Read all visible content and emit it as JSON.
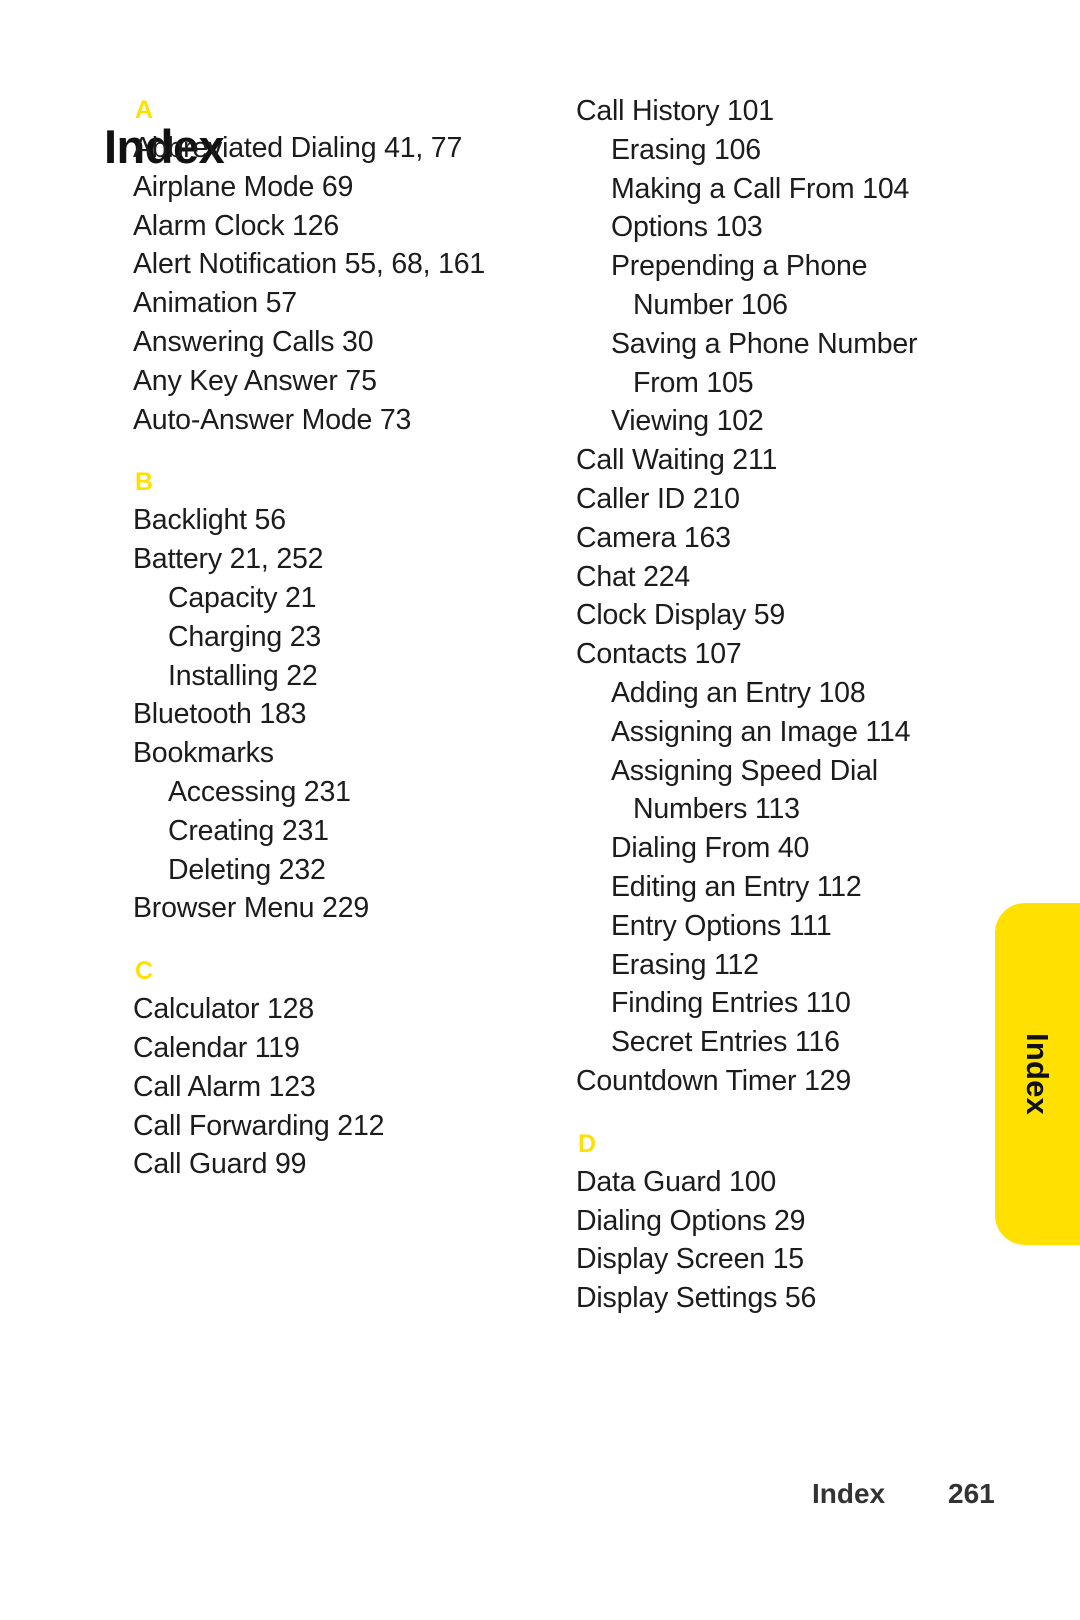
{
  "page": {
    "title": "Index",
    "side_tab_label": "Index",
    "footer_label": "Index",
    "footer_page_number": "261",
    "accent_color": "#FFE000",
    "text_color": "#1c1c1c"
  },
  "columns": [
    {
      "name": "left-column",
      "groups": [
        {
          "letter": "A",
          "entries": [
            {
              "text": "Abbreviated Dialing 41, 77",
              "level": 0
            },
            {
              "text": "Airplane Mode 69",
              "level": 0
            },
            {
              "text": "Alarm Clock 126",
              "level": 0
            },
            {
              "text": "Alert Notification 55, 68, 161",
              "level": 0
            },
            {
              "text": "Animation 57",
              "level": 0
            },
            {
              "text": "Answering Calls 30",
              "level": 0
            },
            {
              "text": "Any Key Answer 75",
              "level": 0
            },
            {
              "text": "Auto-Answer Mode 73",
              "level": 0
            }
          ]
        },
        {
          "letter": "B",
          "entries": [
            {
              "text": "Backlight 56",
              "level": 0
            },
            {
              "text": "Battery 21, 252",
              "level": 0
            },
            {
              "text": "Capacity 21",
              "level": 1
            },
            {
              "text": "Charging 23",
              "level": 1
            },
            {
              "text": "Installing 22",
              "level": 1
            },
            {
              "text": "Bluetooth 183",
              "level": 0
            },
            {
              "text": "Bookmarks",
              "level": 0
            },
            {
              "text": "Accessing 231",
              "level": 1
            },
            {
              "text": "Creating 231",
              "level": 1
            },
            {
              "text": "Deleting 232",
              "level": 1
            },
            {
              "text": "Browser Menu 229",
              "level": 0
            }
          ]
        },
        {
          "letter": "C",
          "entries": [
            {
              "text": "Calculator 128",
              "level": 0
            },
            {
              "text": "Calendar 119",
              "level": 0
            },
            {
              "text": "Call Alarm 123",
              "level": 0
            },
            {
              "text": "Call Forwarding 212",
              "level": 0
            },
            {
              "text": "Call Guard 99",
              "level": 0
            }
          ]
        }
      ]
    },
    {
      "name": "right-column",
      "groups": [
        {
          "letter": "",
          "entries": [
            {
              "text": "Call History 101",
              "level": 0
            },
            {
              "text": "Erasing 106",
              "level": 1
            },
            {
              "text": "Making a Call From 104",
              "level": 1
            },
            {
              "text": "Options 103",
              "level": 1
            },
            {
              "text": "Prepending a Phone",
              "level": 1
            },
            {
              "text": "Number 106",
              "level": 2
            },
            {
              "text": "Saving a Phone Number",
              "level": 1
            },
            {
              "text": "From 105",
              "level": 2
            },
            {
              "text": "Viewing 102",
              "level": 1
            },
            {
              "text": "Call Waiting 211",
              "level": 0
            },
            {
              "text": "Caller ID 210",
              "level": 0
            },
            {
              "text": "Camera 163",
              "level": 0
            },
            {
              "text": "Chat 224",
              "level": 0
            },
            {
              "text": "Clock Display 59",
              "level": 0
            },
            {
              "text": "Contacts 107",
              "level": 0
            },
            {
              "text": "Adding an Entry 108",
              "level": 1
            },
            {
              "text": "Assigning an Image 114",
              "level": 1
            },
            {
              "text": "Assigning Speed Dial",
              "level": 1
            },
            {
              "text": "Numbers 113",
              "level": 2
            },
            {
              "text": "Dialing From 40",
              "level": 1
            },
            {
              "text": "Editing an Entry 112",
              "level": 1
            },
            {
              "text": "Entry Options 111",
              "level": 1
            },
            {
              "text": "Erasing 112",
              "level": 1
            },
            {
              "text": "Finding Entries 110",
              "level": 1
            },
            {
              "text": "Secret Entries 116",
              "level": 1
            },
            {
              "text": "Countdown Timer 129",
              "level": 0
            }
          ]
        },
        {
          "letter": "D",
          "entries": [
            {
              "text": "Data Guard 100",
              "level": 0
            },
            {
              "text": "Dialing Options 29",
              "level": 0
            },
            {
              "text": "Display Screen 15",
              "level": 0
            },
            {
              "text": "Display Settings 56",
              "level": 0
            }
          ]
        }
      ]
    }
  ]
}
